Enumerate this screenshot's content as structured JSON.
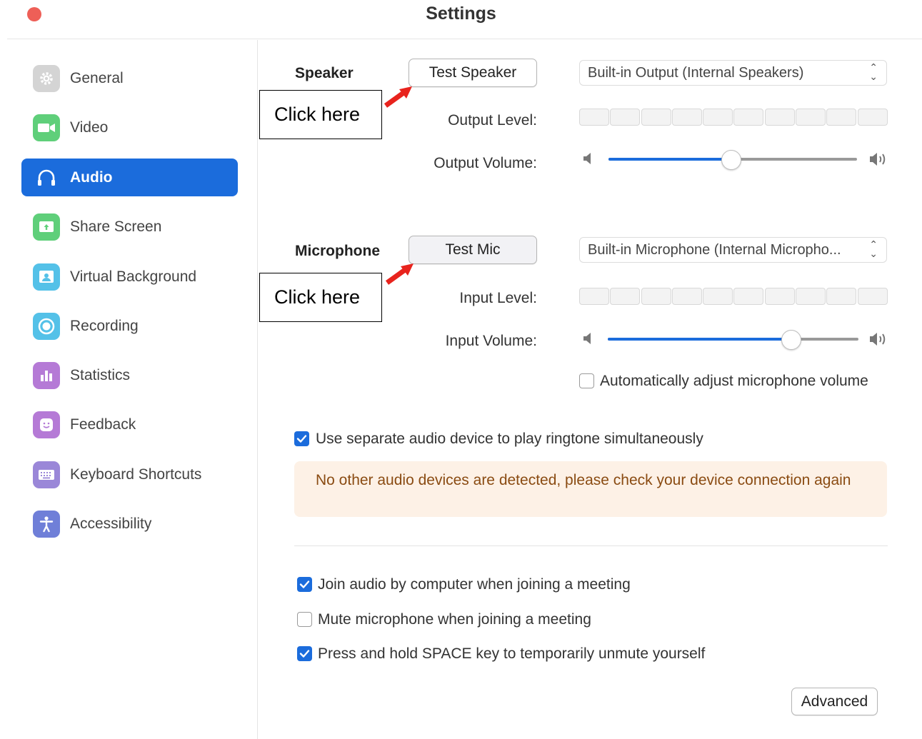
{
  "window": {
    "title": "Settings"
  },
  "sidebar": {
    "items": [
      {
        "label": "General",
        "icon": "gear-icon",
        "color": "#d4d4d4"
      },
      {
        "label": "Video",
        "icon": "video-camera-icon",
        "color": "#5fcf7a"
      },
      {
        "label": "Audio",
        "icon": "headphones-icon",
        "color": "#1b6cdc",
        "active": true
      },
      {
        "label": "Share Screen",
        "icon": "share-screen-icon",
        "color": "#5fcf7a"
      },
      {
        "label": "Virtual Background",
        "icon": "virtual-background-icon",
        "color": "#54c1e8"
      },
      {
        "label": "Recording",
        "icon": "recording-icon",
        "color": "#54c1e8"
      },
      {
        "label": "Statistics",
        "icon": "statistics-icon",
        "color": "#b57ad6"
      },
      {
        "label": "Feedback",
        "icon": "feedback-icon",
        "color": "#b57ad6"
      },
      {
        "label": "Keyboard Shortcuts",
        "icon": "keyboard-icon",
        "color": "#9a87d8"
      },
      {
        "label": "Accessibility",
        "icon": "accessibility-icon",
        "color": "#6f7fd8"
      }
    ]
  },
  "speaker": {
    "heading": "Speaker",
    "test_button": "Test Speaker",
    "device": "Built-in Output (Internal Speakers)",
    "output_level_label": "Output Level:",
    "output_volume_label": "Output Volume:",
    "output_volume": 0.49
  },
  "microphone": {
    "heading": "Microphone",
    "test_button": "Test Mic",
    "device": "Built-in Microphone (Internal Micropho...",
    "input_level_label": "Input Level:",
    "input_volume_label": "Input Volume:",
    "input_volume": 0.73,
    "auto_adjust_label": "Automatically adjust microphone volume",
    "auto_adjust": false
  },
  "ringtone": {
    "label": "Use separate audio device to play ringtone simultaneously",
    "checked": true,
    "warning": "No other audio devices are detected, please check your device connection again"
  },
  "options": [
    {
      "label": "Join audio by computer when joining a meeting",
      "checked": true
    },
    {
      "label": "Mute microphone when joining a meeting",
      "checked": false
    },
    {
      "label": "Press and hold SPACE key to temporarily unmute yourself",
      "checked": true
    }
  ],
  "advanced_button": "Advanced",
  "annotations": {
    "speaker_callout": "Click here",
    "mic_callout": "Click here",
    "arrow_color": "#e8231d"
  },
  "colors": {
    "accent": "#1b6cdc",
    "warning_bg": "#fdf1e6",
    "warning_text": "#8a4b12"
  }
}
